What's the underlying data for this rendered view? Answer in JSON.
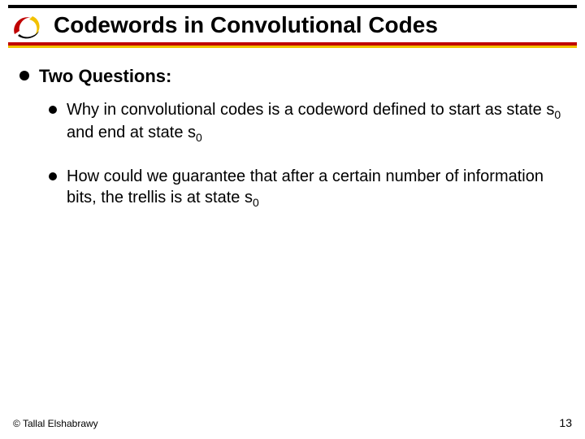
{
  "header": {
    "title": "Codewords in Convolutional Codes"
  },
  "content": {
    "heading": "Two Questions:",
    "items": [
      {
        "pre": "Why in convolutional codes is a codeword defined to start as state s",
        "sub1": "0",
        "mid": " and end at state s",
        "sub2": "0",
        "post": ""
      },
      {
        "pre": "How could we guarantee that after a certain number of information bits, the trellis is at state s",
        "sub1": "0",
        "mid": "",
        "sub2": "",
        "post": ""
      }
    ]
  },
  "footer": {
    "copyright": "© Tallal Elshabrawy",
    "page": "13"
  }
}
